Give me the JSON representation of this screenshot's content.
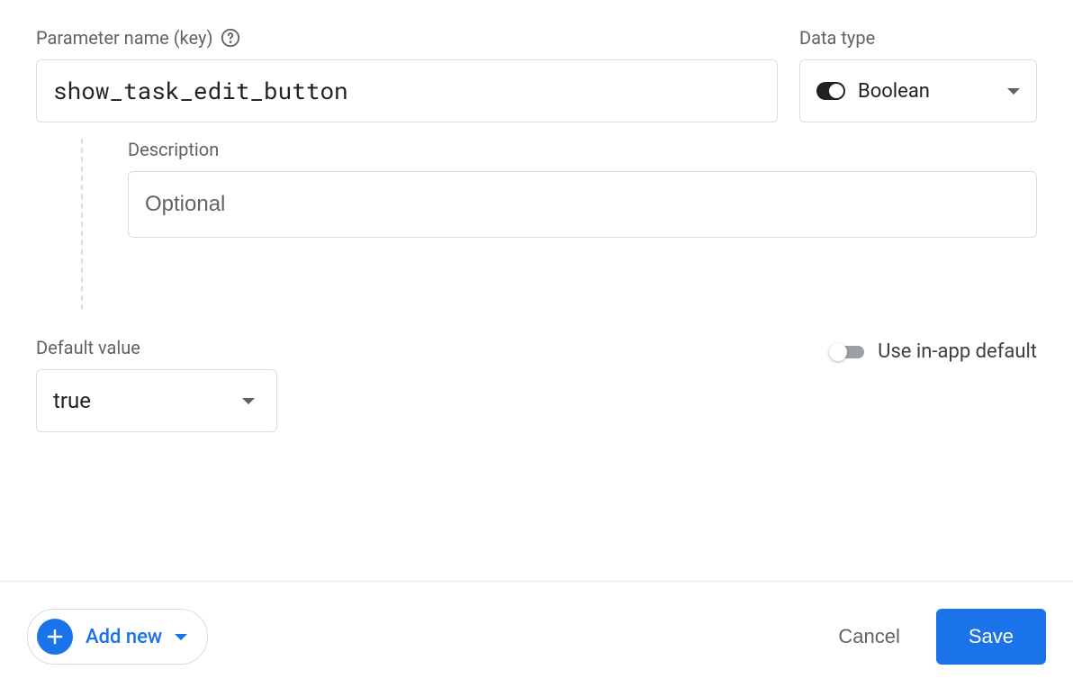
{
  "parameterName": {
    "label": "Parameter name (key)",
    "value": "show_task_edit_button"
  },
  "dataType": {
    "label": "Data type",
    "selected": "Boolean"
  },
  "description": {
    "label": "Description",
    "placeholder": "Optional",
    "value": ""
  },
  "defaultValue": {
    "label": "Default value",
    "selected": "true"
  },
  "inAppDefault": {
    "label": "Use in-app default",
    "enabled": false
  },
  "footer": {
    "addNew": "Add new",
    "cancel": "Cancel",
    "save": "Save"
  }
}
